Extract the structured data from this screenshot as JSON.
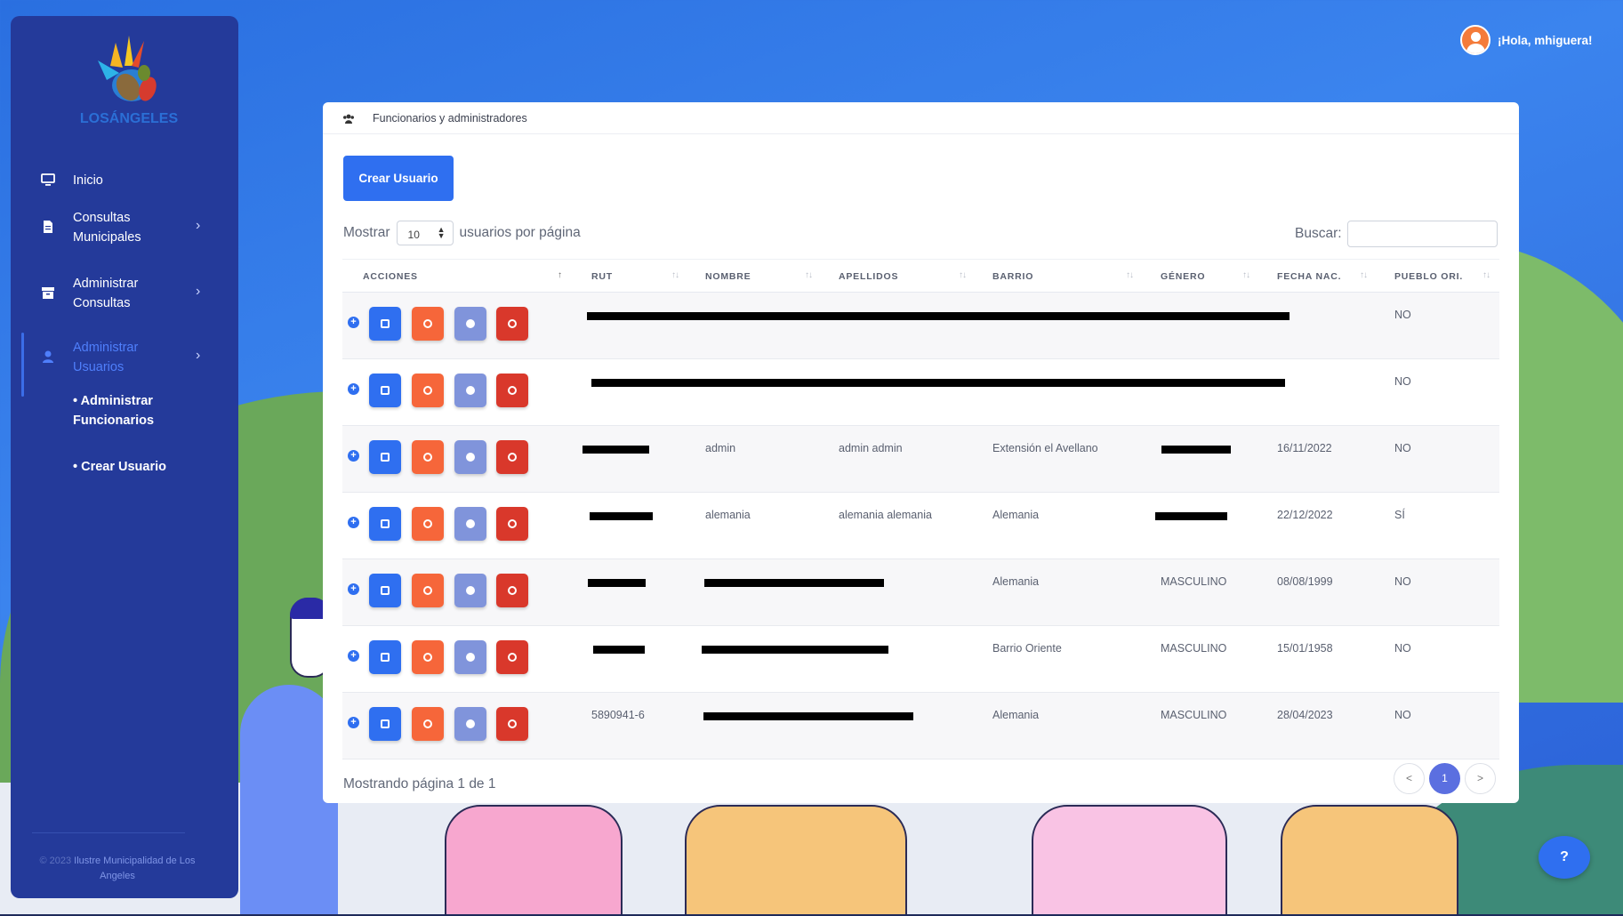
{
  "header": {
    "greeting": "¡Hola, mhiguera!"
  },
  "sidebar": {
    "logo_text": "LOSÁNGELES",
    "items": [
      {
        "label": "Inicio",
        "icon": "monitor-icon",
        "has_submenu": false
      },
      {
        "label": "Consultas Municipales",
        "icon": "document-icon",
        "has_submenu": true
      },
      {
        "label": "Administrar Consultas",
        "icon": "archive-icon",
        "has_submenu": true
      },
      {
        "label": "Administrar Usuarios",
        "icon": "user-icon",
        "has_submenu": true,
        "active": true
      }
    ],
    "subitems": [
      "• Administrar Funcionarios",
      "• Crear Usuario"
    ],
    "footer_year": "© 2023",
    "footer_org": "Ilustre Municipalidad de Los Angeles"
  },
  "card": {
    "title": "Funcionarios y administradores",
    "create_button": "Crear Usuario",
    "show_prefix": "Mostrar",
    "page_size": "10",
    "show_suffix": "usuarios por página",
    "search_label": "Buscar:",
    "search_value": "",
    "columns": [
      "ACCIONES",
      "RUT",
      "NOMBRE",
      "APELLIDOS",
      "BARRIO",
      "GÉNERO",
      "FECHA NAC.",
      "PUEBLO ORI."
    ],
    "rows": [
      {
        "rut": "",
        "nombre": "",
        "apellidos": "",
        "barrio": "",
        "genero": "",
        "fecha": "",
        "pueblo": "NO"
      },
      {
        "rut": "",
        "nombre": "",
        "apellidos": "",
        "barrio": "",
        "genero": "",
        "fecha": "",
        "pueblo": "NO"
      },
      {
        "rut": "",
        "nombre": "admin",
        "apellidos": "admin admin",
        "barrio": "Extensión el Avellano",
        "genero": "",
        "fecha": "16/11/2022",
        "pueblo": "NO"
      },
      {
        "rut": "",
        "nombre": "alemania",
        "apellidos": "alemania alemania",
        "barrio": "Alemania",
        "genero": "",
        "fecha": "22/12/2022",
        "pueblo": "SÍ"
      },
      {
        "rut": "",
        "nombre": "",
        "apellidos": "",
        "barrio": "Alemania",
        "genero": "MASCULINO",
        "fecha": "08/08/1999",
        "pueblo": "NO"
      },
      {
        "rut": "",
        "nombre": "",
        "apellidos": "",
        "barrio": "Barrio Oriente",
        "genero": "MASCULINO",
        "fecha": "15/01/1958",
        "pueblo": "NO"
      },
      {
        "rut": "5890941-6",
        "nombre": "",
        "apellidos": "",
        "barrio": "Alemania",
        "genero": "MASCULINO",
        "fecha": "28/04/2023",
        "pueblo": "NO"
      }
    ],
    "pagination_info": "Mostrando página 1 de 1",
    "pager": {
      "prev": "<",
      "current": "1",
      "next": ">"
    }
  },
  "help_button": "?",
  "colors": {
    "sidebar": "#243a9a",
    "primary": "#2f6ff0",
    "key": "#f6663a",
    "view": "#8094db",
    "delete": "#d9382b"
  }
}
